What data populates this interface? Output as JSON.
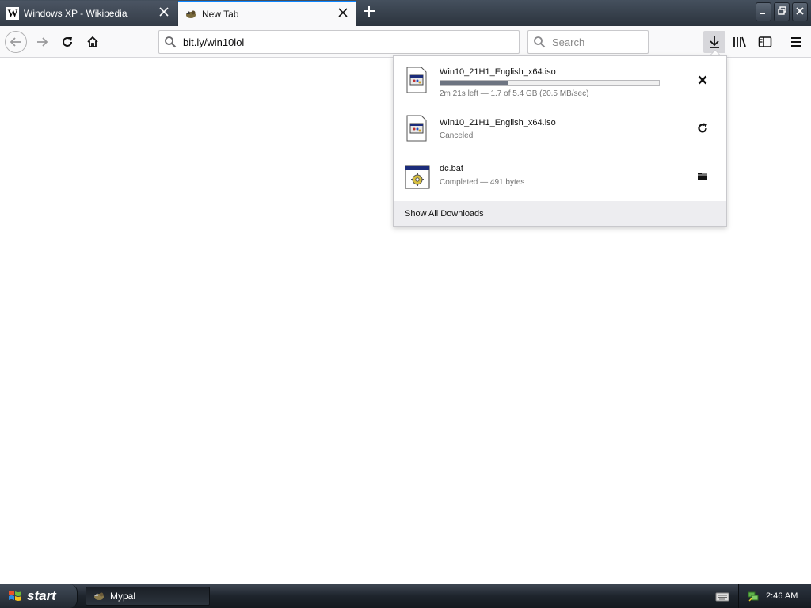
{
  "tabs": [
    {
      "title": "Windows XP - Wikipedia",
      "active": false,
      "favicon": "wikipedia-w-icon"
    },
    {
      "title": "New Tab",
      "active": true,
      "favicon": "mypal-bird-icon"
    }
  ],
  "navbar": {
    "url": "bit.ly/win10lol",
    "search_placeholder": "Search"
  },
  "downloads": {
    "items": [
      {
        "name": "Win10_21H1_English_x64.iso",
        "status": "2m 21s left — 1.7 of 5.4 GB (20.5 MB/sec)",
        "progress": 0.31,
        "action": "cancel-x-icon"
      },
      {
        "name": "Win10_21H1_English_x64.iso",
        "status": "Canceled",
        "action": "retry-icon"
      },
      {
        "name": "dc.bat",
        "status": "Completed — 491 bytes",
        "action": "open-folder-icon"
      }
    ],
    "footer_label": "Show All Downloads"
  },
  "taskbar": {
    "start_label": "start",
    "task_label": "Mypal",
    "clock": "2:46 AM"
  },
  "colors": {
    "accent": "#0a84ff",
    "tabstrip": "#2b333d",
    "progress_fill": "#6d7481"
  }
}
